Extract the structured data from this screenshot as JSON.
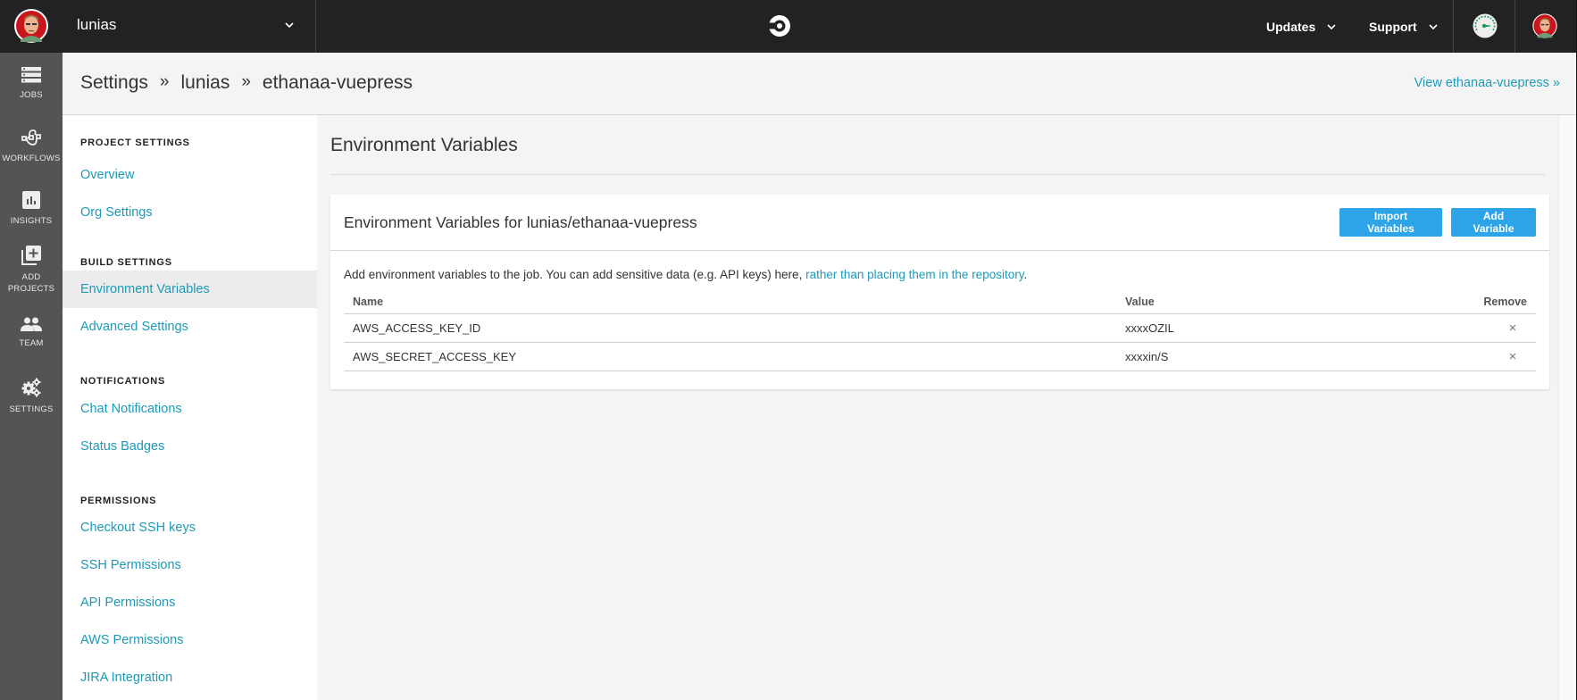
{
  "topbar": {
    "org_name": "lunias",
    "logo": "circleci-logo",
    "menus": [
      {
        "label": "Updates",
        "icon": "chevron-down-icon"
      },
      {
        "label": "Support",
        "icon": "chevron-down-icon"
      }
    ],
    "status_icon": "gauge-icon",
    "user_avatar": "avatar"
  },
  "leftnav": {
    "items": [
      {
        "label": "JOBS",
        "icon": "jobs-icon"
      },
      {
        "label": "WORKFLOWS",
        "icon": "workflows-icon"
      },
      {
        "label": "INSIGHTS",
        "icon": "insights-icon"
      },
      {
        "label_line1": "ADD",
        "label_line2": "PROJECTS",
        "icon": "add-projects-icon"
      },
      {
        "label": "TEAM",
        "icon": "team-icon"
      },
      {
        "label": "SETTINGS",
        "icon": "settings-icon"
      }
    ]
  },
  "breadcrumb": {
    "items": [
      "Settings",
      "lunias",
      "ethanaa-vuepress"
    ],
    "separator": "»",
    "view_link": "View ethanaa-vuepress »"
  },
  "settings_sidebar": {
    "sections": [
      {
        "heading": "PROJECT SETTINGS",
        "links": [
          "Overview",
          "Org Settings"
        ]
      },
      {
        "heading": "BUILD SETTINGS",
        "links": [
          "Environment Variables",
          "Advanced Settings"
        ]
      },
      {
        "heading": "NOTIFICATIONS",
        "links": [
          "Chat Notifications",
          "Status Badges"
        ]
      },
      {
        "heading": "PERMISSIONS",
        "links": [
          "Checkout SSH keys",
          "SSH Permissions",
          "API Permissions",
          "AWS Permissions",
          "JIRA Integration"
        ]
      }
    ],
    "active": "Environment Variables"
  },
  "main": {
    "title": "Environment Variables",
    "card": {
      "title": "Environment Variables for lunias/ethanaa-vuepress",
      "import_button": "Import Variables",
      "add_button": "Add Variable",
      "description": "Add environment variables to the job. You can add sensitive data (e.g. API keys) here, ",
      "description_link": "rather than placing them in the repository",
      "description_end": ".",
      "table": {
        "headers": [
          "Name",
          "Value",
          "Remove"
        ],
        "rows": [
          {
            "name": "AWS_ACCESS_KEY_ID",
            "value": "xxxxOZIL",
            "remove": "×"
          },
          {
            "name": "AWS_SECRET_ACCESS_KEY",
            "value": "xxxxin/S",
            "remove": "×"
          }
        ]
      }
    }
  },
  "colors": {
    "topbar_bg": "#222222",
    "leftnav_bg": "#545454",
    "link": "#1d9ab8",
    "button": "#2ea4e8",
    "page_bg": "#f4f4f4"
  }
}
